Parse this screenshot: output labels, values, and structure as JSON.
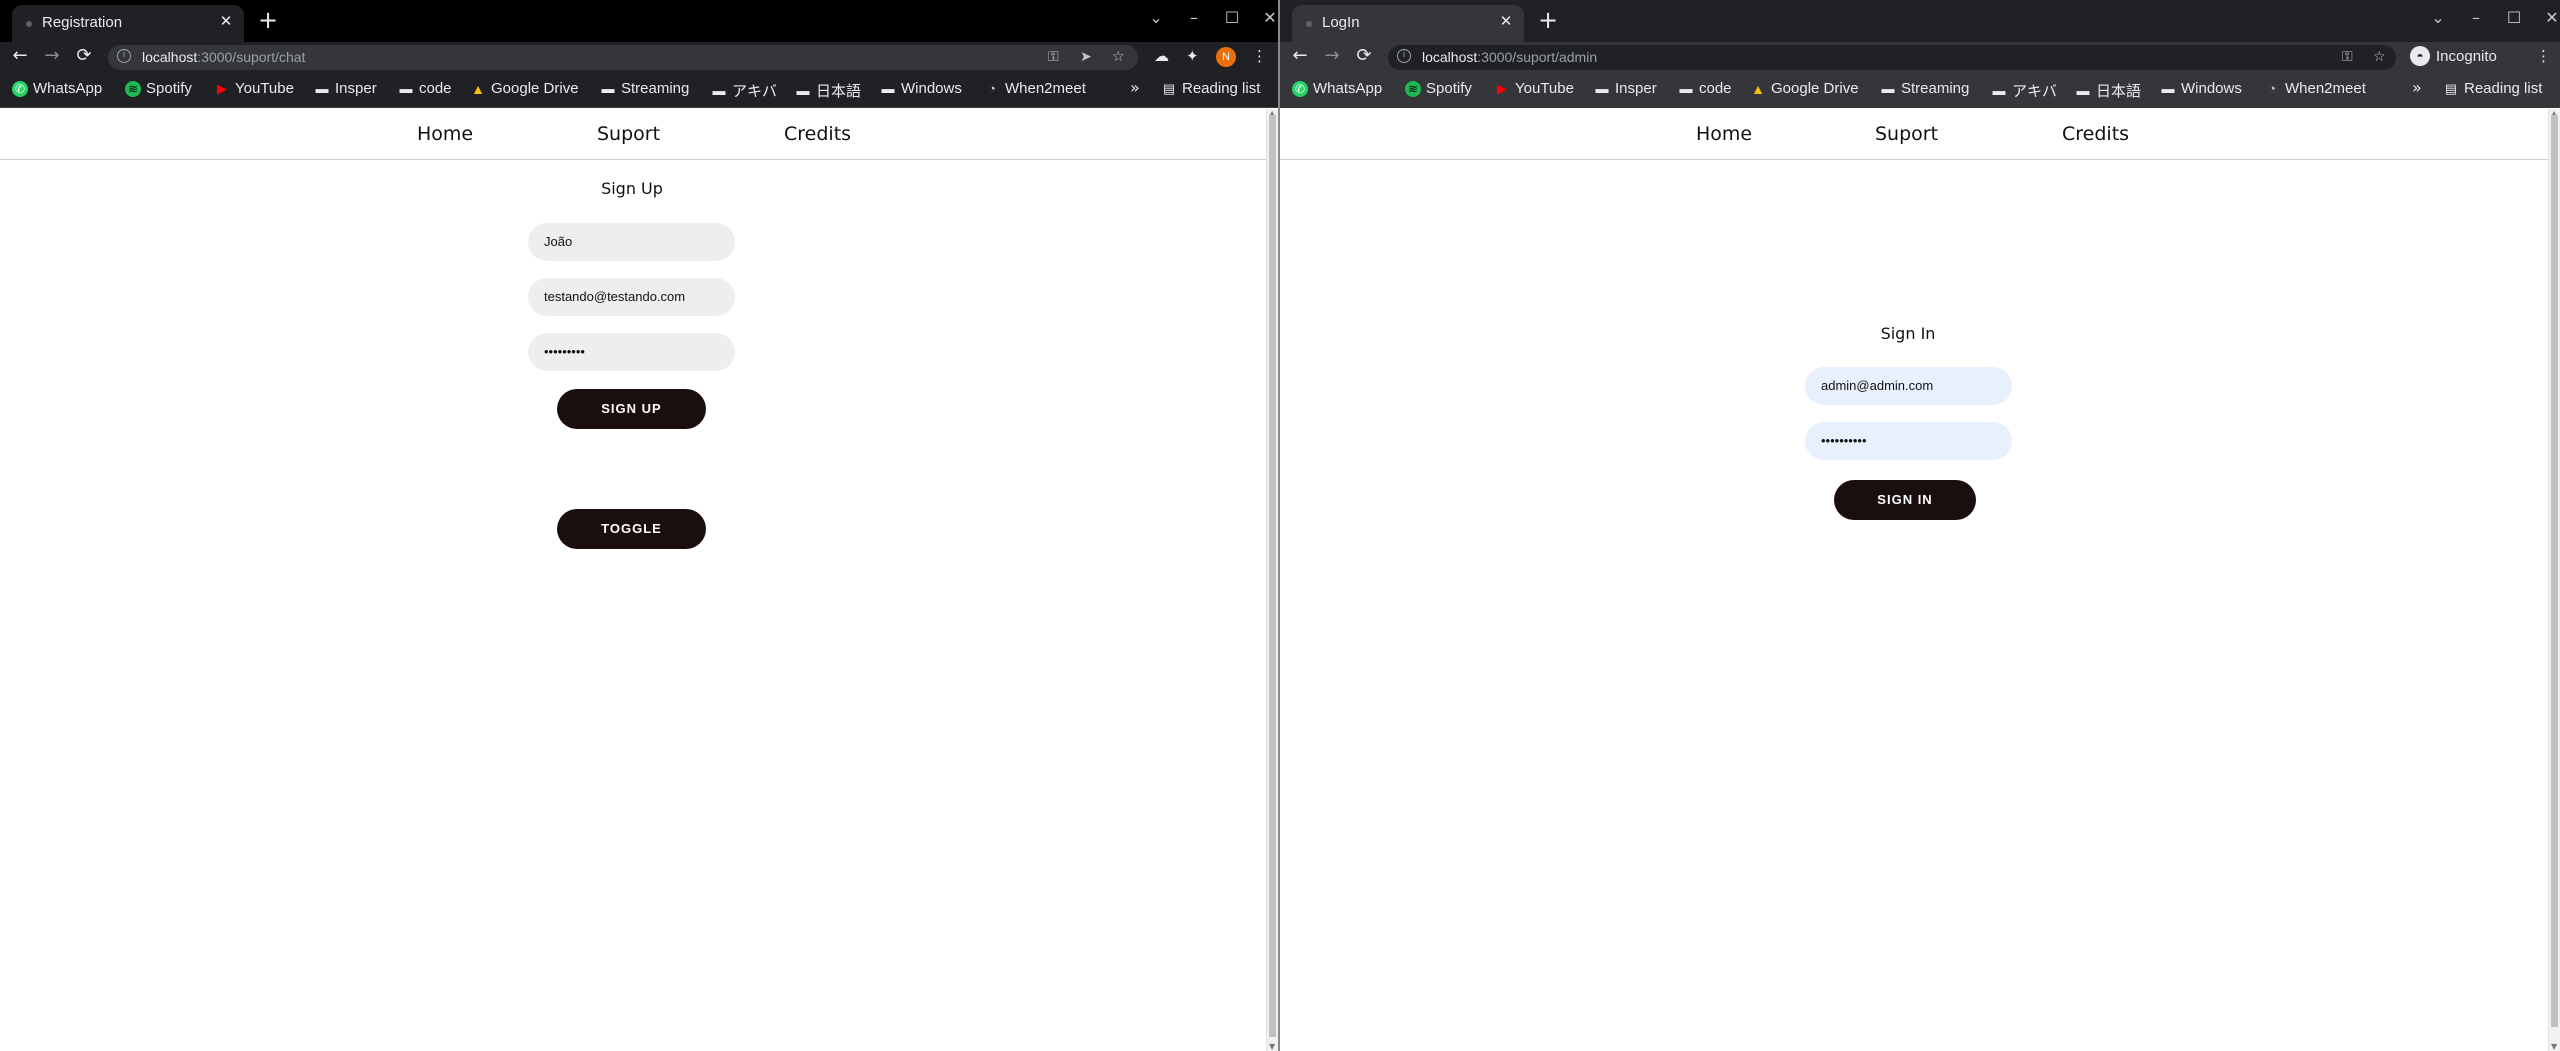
{
  "left": {
    "tab_title": "Registration",
    "url_host": "localhost",
    "url_rest": ":3000/suport/chat",
    "profile_initial": "N",
    "nav": {
      "home": "Home",
      "suport": "Suport",
      "credits": "Credits"
    },
    "form": {
      "title": "Sign Up",
      "name_value": "João",
      "email_value": "testando@testando.com",
      "password_value": "•••••••••",
      "submit_label": "SIGN UP",
      "toggle_label": "TOGGLE"
    }
  },
  "right": {
    "tab_title": "LogIn",
    "url_host": "localhost",
    "url_rest": ":3000/suport/admin",
    "incognito_label": "Incognito",
    "nav": {
      "home": "Home",
      "suport": "Suport",
      "credits": "Credits"
    },
    "form": {
      "title": "Sign In",
      "email_value": "admin@admin.com",
      "password_value": "••••••••••",
      "submit_label": "SIGN IN"
    }
  },
  "bookmarks": {
    "whatsapp": "WhatsApp",
    "spotify": "Spotify",
    "youtube": "YouTube",
    "insper": "Insper",
    "code": "code",
    "google_drive": "Google Drive",
    "streaming": "Streaming",
    "akiba": "アキバ",
    "nihongo": "日本語",
    "windows": "Windows",
    "when2meet": "When2meet",
    "more": "»",
    "reading_list": "Reading list"
  },
  "icons": {
    "back": "←",
    "forward": "→",
    "reload": "⟳",
    "close": "✕",
    "new_tab": "+",
    "minimize": "–",
    "maximize": "☐",
    "star": "☆",
    "key": "⚿",
    "menu": "⋮",
    "send": "➤",
    "puzzle": "✦"
  }
}
